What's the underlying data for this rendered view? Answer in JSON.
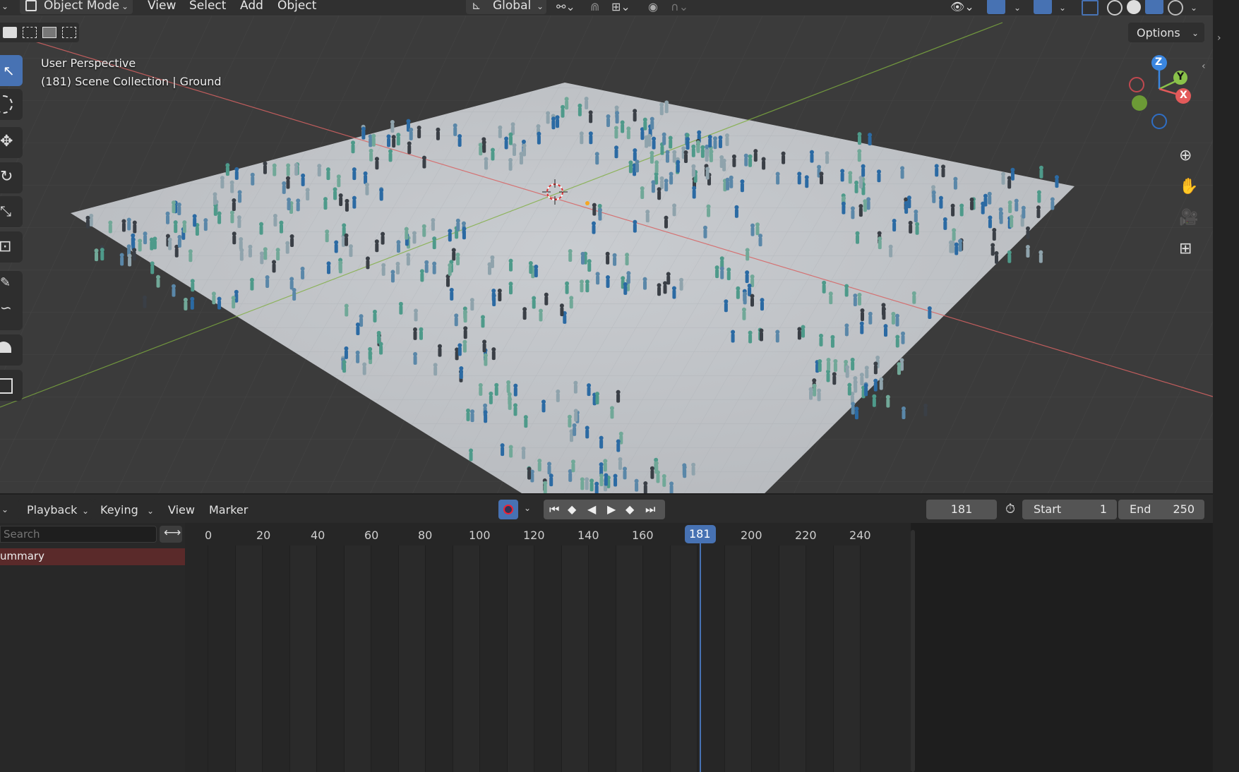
{
  "header": {
    "mode": "Object Mode",
    "menus": [
      "View",
      "Select",
      "Add",
      "Object"
    ],
    "orientation": "Global",
    "options_label": "Options"
  },
  "viewport": {
    "line1": "User Perspective",
    "line2": "(181) Scene Collection | Ground",
    "gizmo": {
      "z": "Z",
      "y": "Y",
      "x": "X"
    }
  },
  "timeline": {
    "menus": [
      "Playback",
      "Keying",
      "View",
      "Marker"
    ],
    "current_frame": "181",
    "start_label": "Start",
    "start_value": "1",
    "end_label": "End",
    "end_value": "250",
    "search_placeholder": "Search",
    "summary_label": "ummary",
    "ruler": [
      "0",
      "20",
      "40",
      "60",
      "80",
      "100",
      "120",
      "140",
      "160",
      "200",
      "220",
      "240"
    ],
    "playhead_label": "181"
  },
  "colors": {
    "accent": "#4772b3",
    "summary_bg": "#5a2a2a",
    "axis_x": "#e35a5a",
    "axis_y": "#8ac24a",
    "axis_z": "#3a86e0"
  }
}
